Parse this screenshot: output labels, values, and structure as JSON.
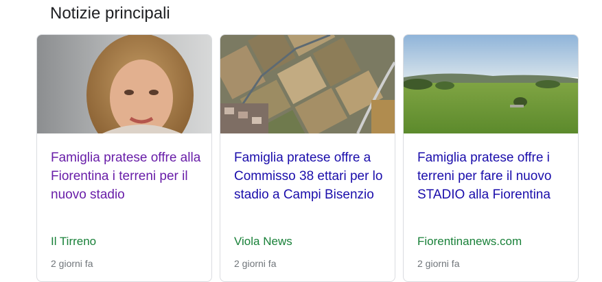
{
  "section": {
    "title": "Notizie principali"
  },
  "cards": [
    {
      "headline": "Famiglia pratese offre alla Fiorentina i terreni per il nuovo stadio",
      "source": "Il Tirreno",
      "time": "2 giorni fa",
      "visited": true,
      "thumbnail": "portrait-photo"
    },
    {
      "headline": "Famiglia pratese offre a Commisso 38 ettari per lo stadio a Campi Bisenzio",
      "source": "Viola News",
      "time": "2 giorni fa",
      "visited": false,
      "thumbnail": "aerial-fields-photo"
    },
    {
      "headline": "Famiglia pratese offre i terreni per fare il nuovo STADIO alla Fiorentina",
      "source": "Fiorentinanews.com",
      "time": "2 giorni fa",
      "visited": false,
      "thumbnail": "green-field-photo"
    }
  ],
  "colors": {
    "link": "#1a0dab",
    "visited_link": "#681da8",
    "source": "#188038",
    "meta": "#70757a"
  }
}
